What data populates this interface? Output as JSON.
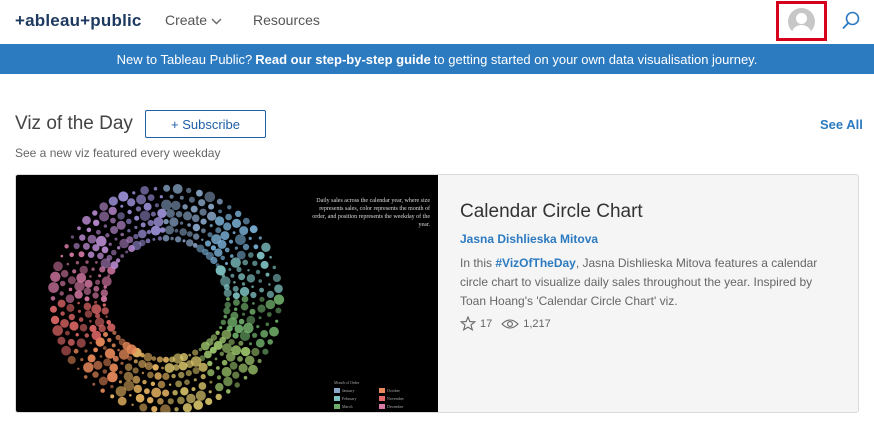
{
  "header": {
    "logo_text": "+ableau+public",
    "nav": {
      "create": "Create",
      "resources": "Resources"
    },
    "icons": {
      "avatar": "user-avatar-icon",
      "search": "search-icon",
      "caret": "chevron-down-icon"
    }
  },
  "banner": {
    "lead": "New to Tableau Public?",
    "link": "Read our step-by-step guide",
    "tail": "to getting started on your own data visualisation journey."
  },
  "section": {
    "title": "Viz of the Day",
    "subscribe_label": "+ Subscribe",
    "see_all_label": "See All",
    "subtitle": "See a new viz featured every weekday"
  },
  "card": {
    "title": "Calendar Circle Chart",
    "author": "Jasna Dishlieska Mitova",
    "desc_prefix": "In this",
    "desc_tag": "#VizOfTheDay",
    "desc_rest": ", Jasna Dishlieska Mitova features a calendar circle chart to visualize daily sales throughout the year. Inspired by Toan Hoang's 'Calendar Circle Chart' viz.",
    "favorites": "17",
    "views": "1,217",
    "thumbnail": {
      "description": "Daily sales across the calendar year, where size represents sales, color represents the month of order, and position represents the weekday of the year.",
      "legend_title": "Month of Order",
      "legend_items": [
        "January",
        "October",
        "February",
        "November",
        "March",
        "December"
      ],
      "legend_colors": [
        "#8aa7c9",
        "#e88a5a",
        "#7fc2c2",
        "#e46a6a",
        "#6fae6a",
        "#d77aa6"
      ]
    }
  },
  "colors": {
    "accent": "#2c7ac0",
    "banner_bg": "#2c7ac0",
    "highlight_box": "#d6001c"
  }
}
